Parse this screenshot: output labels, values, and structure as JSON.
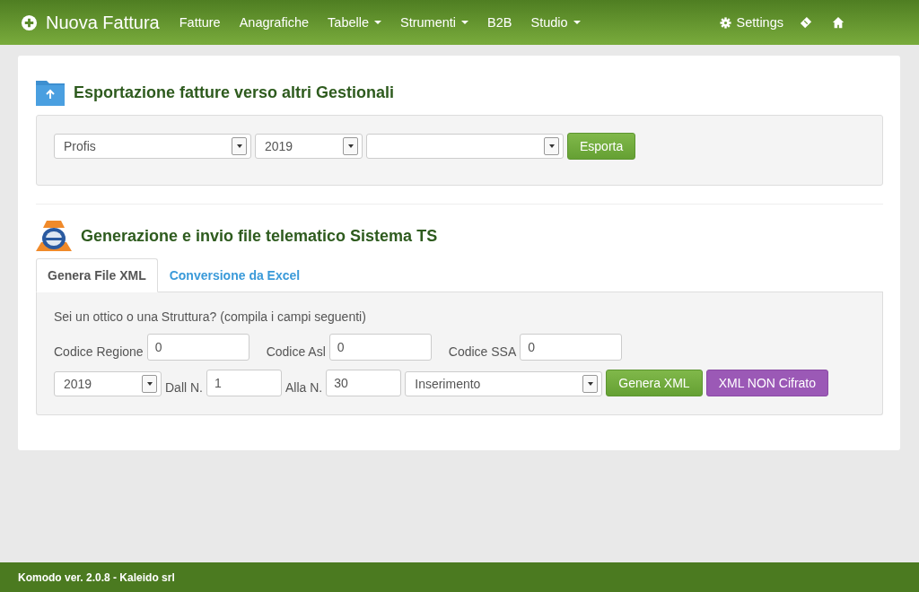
{
  "navbar": {
    "brand": "Nuova Fattura",
    "items": [
      {
        "label": "Fatture",
        "dropdown": false
      },
      {
        "label": "Anagrafiche",
        "dropdown": false
      },
      {
        "label": "Tabelle",
        "dropdown": true
      },
      {
        "label": "Strumenti",
        "dropdown": true
      },
      {
        "label": "B2B",
        "dropdown": false
      },
      {
        "label": "Studio",
        "dropdown": true
      }
    ],
    "settings": "Settings"
  },
  "export": {
    "title": "Esportazione fatture verso altri Gestionali",
    "selects": [
      "Profis",
      "2019"
    ],
    "button": "Esporta"
  },
  "ts": {
    "title": "Generazione e invio file telematico Sistema TS",
    "tabs": [
      {
        "label": "Genera File XML",
        "selected": true
      },
      {
        "label": "Conversione da Excel",
        "selected": false
      }
    ],
    "hint": "Sei un ottico o una Struttura? (compila i campi seguenti)",
    "codes": [
      {
        "label": "Codice Regione",
        "value": "0"
      },
      {
        "label": "Codice Asl",
        "value": "0"
      },
      {
        "label": "Codice SSA",
        "value": "0"
      }
    ],
    "year": "2019",
    "from_label": "Dall N.",
    "from": "1",
    "to_label": "Alla N.",
    "to": "30",
    "mode": "Inserimento",
    "buttons": [
      {
        "label": "Genera XML",
        "kind": "success"
      },
      {
        "label": "XML NON Cifrato",
        "kind": "purple"
      }
    ]
  },
  "footer": "Komodo ver. 2.0.8 - Kaleido srl"
}
